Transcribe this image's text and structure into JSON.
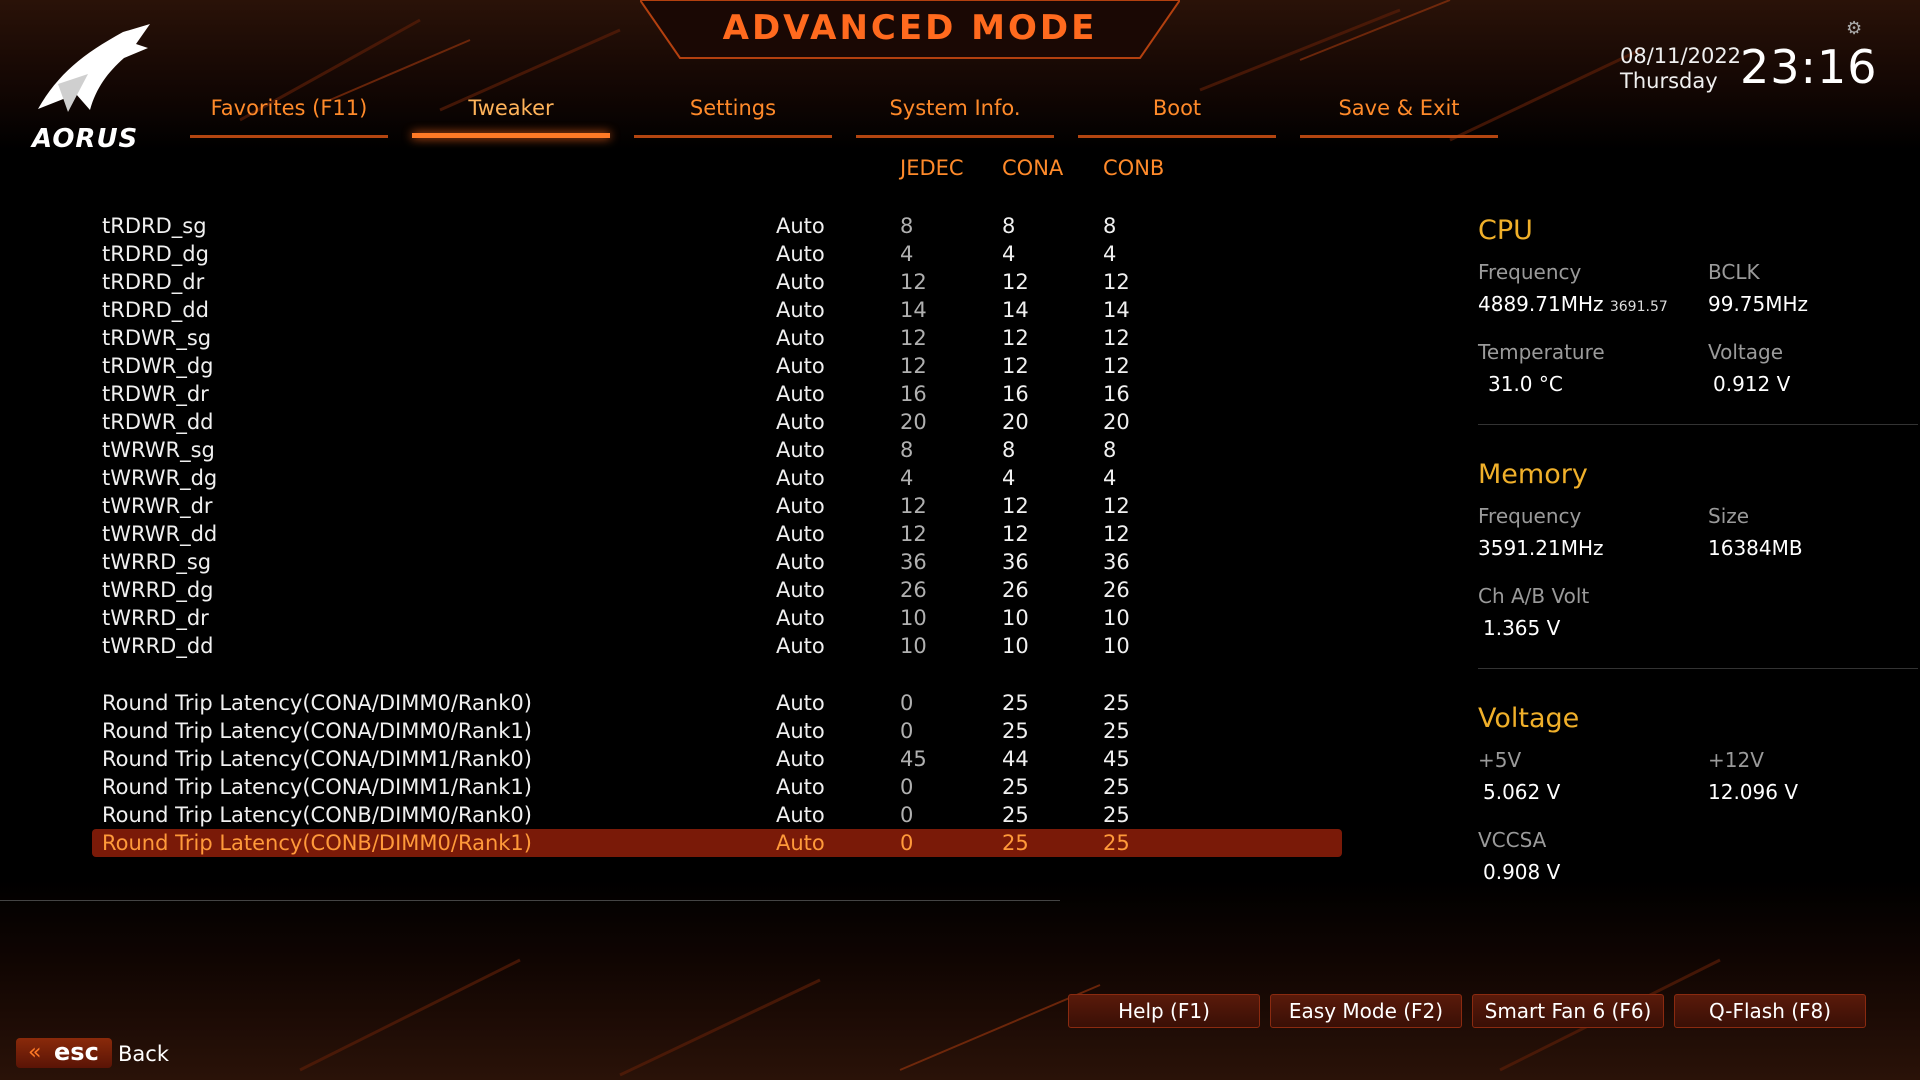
{
  "header": {
    "title": "ADVANCED MODE",
    "logo_text": "AORUS",
    "date": "08/11/2022",
    "weekday": "Thursday",
    "time": "23:16"
  },
  "tabs": [
    {
      "label": "Favorites (F11)",
      "active": false
    },
    {
      "label": "Tweaker",
      "active": true
    },
    {
      "label": "Settings",
      "active": false
    },
    {
      "label": "System Info.",
      "active": false
    },
    {
      "label": "Boot",
      "active": false
    },
    {
      "label": "Save & Exit",
      "active": false
    }
  ],
  "columns": {
    "jedec": "JEDEC",
    "cona": "CONA",
    "conb": "CONB"
  },
  "rows": [
    {
      "name": "tRDRD_sg",
      "value": "Auto",
      "jedec": "8",
      "cona": "8",
      "conb": "8"
    },
    {
      "name": "tRDRD_dg",
      "value": "Auto",
      "jedec": "4",
      "cona": "4",
      "conb": "4"
    },
    {
      "name": "tRDRD_dr",
      "value": "Auto",
      "jedec": "12",
      "cona": "12",
      "conb": "12"
    },
    {
      "name": "tRDRD_dd",
      "value": "Auto",
      "jedec": "14",
      "cona": "14",
      "conb": "14"
    },
    {
      "name": "tRDWR_sg",
      "value": "Auto",
      "jedec": "12",
      "cona": "12",
      "conb": "12"
    },
    {
      "name": "tRDWR_dg",
      "value": "Auto",
      "jedec": "12",
      "cona": "12",
      "conb": "12"
    },
    {
      "name": "tRDWR_dr",
      "value": "Auto",
      "jedec": "16",
      "cona": "16",
      "conb": "16"
    },
    {
      "name": "tRDWR_dd",
      "value": "Auto",
      "jedec": "20",
      "cona": "20",
      "conb": "20"
    },
    {
      "name": "tWRWR_sg",
      "value": "Auto",
      "jedec": "8",
      "cona": "8",
      "conb": "8"
    },
    {
      "name": "tWRWR_dg",
      "value": "Auto",
      "jedec": "4",
      "cona": "4",
      "conb": "4"
    },
    {
      "name": "tWRWR_dr",
      "value": "Auto",
      "jedec": "12",
      "cona": "12",
      "conb": "12"
    },
    {
      "name": "tWRWR_dd",
      "value": "Auto",
      "jedec": "12",
      "cona": "12",
      "conb": "12"
    },
    {
      "name": "tWRRD_sg",
      "value": "Auto",
      "jedec": "36",
      "cona": "36",
      "conb": "36"
    },
    {
      "name": "tWRRD_dg",
      "value": "Auto",
      "jedec": "26",
      "cona": "26",
      "conb": "26"
    },
    {
      "name": "tWRRD_dr",
      "value": "Auto",
      "jedec": "10",
      "cona": "10",
      "conb": "10"
    },
    {
      "name": "tWRRD_dd",
      "value": "Auto",
      "jedec": "10",
      "cona": "10",
      "conb": "10"
    },
    {
      "name": "Round Trip Latency(CONA/DIMM0/Rank0)",
      "value": "Auto",
      "jedec": "0",
      "cona": "25",
      "conb": "25"
    },
    {
      "name": "Round Trip Latency(CONA/DIMM0/Rank1)",
      "value": "Auto",
      "jedec": "0",
      "cona": "25",
      "conb": "25"
    },
    {
      "name": "Round Trip Latency(CONA/DIMM1/Rank0)",
      "value": "Auto",
      "jedec": "45",
      "cona": "44",
      "conb": "45"
    },
    {
      "name": "Round Trip Latency(CONA/DIMM1/Rank1)",
      "value": "Auto",
      "jedec": "0",
      "cona": "25",
      "conb": "25"
    },
    {
      "name": "Round Trip Latency(CONB/DIMM0/Rank0)",
      "value": "Auto",
      "jedec": "0",
      "cona": "25",
      "conb": "25"
    },
    {
      "name": "Round Trip Latency(CONB/DIMM0/Rank1)",
      "value": "Auto",
      "jedec": "0",
      "cona": "25",
      "conb": "25",
      "selected": true
    }
  ],
  "panel": {
    "cpu": {
      "title": "CPU",
      "freq_label": "Frequency",
      "freq": "4889.71MHz",
      "freq_sub": "3691.57",
      "bclk_label": "BCLK",
      "bclk": "99.75MHz",
      "temp_label": "Temperature",
      "temp": "31.0 °C",
      "volt_label": "Voltage",
      "volt": "0.912 V"
    },
    "memory": {
      "title": "Memory",
      "freq_label": "Frequency",
      "freq": "3591.21MHz",
      "size_label": "Size",
      "size": "16384MB",
      "chvolt_label": "Ch A/B Volt",
      "chvolt": "1.365 V"
    },
    "voltage": {
      "title": "Voltage",
      "p5_label": "+5V",
      "p5": "5.062 V",
      "p12_label": "+12V",
      "p12": "12.096 V",
      "vccsa_label": "VCCSA",
      "vccsa": "0.908 V"
    }
  },
  "buttons": {
    "help": "Help (F1)",
    "easy": "Easy Mode (F2)",
    "fan": "Smart Fan 6 (F6)",
    "qflash": "Q-Flash (F8)"
  },
  "footer": {
    "esc": "esc",
    "back": "Back"
  },
  "colors": {
    "accent": "#ff6a1e",
    "selected_row": "#7a1a08",
    "section_title": "#f0b02a"
  }
}
